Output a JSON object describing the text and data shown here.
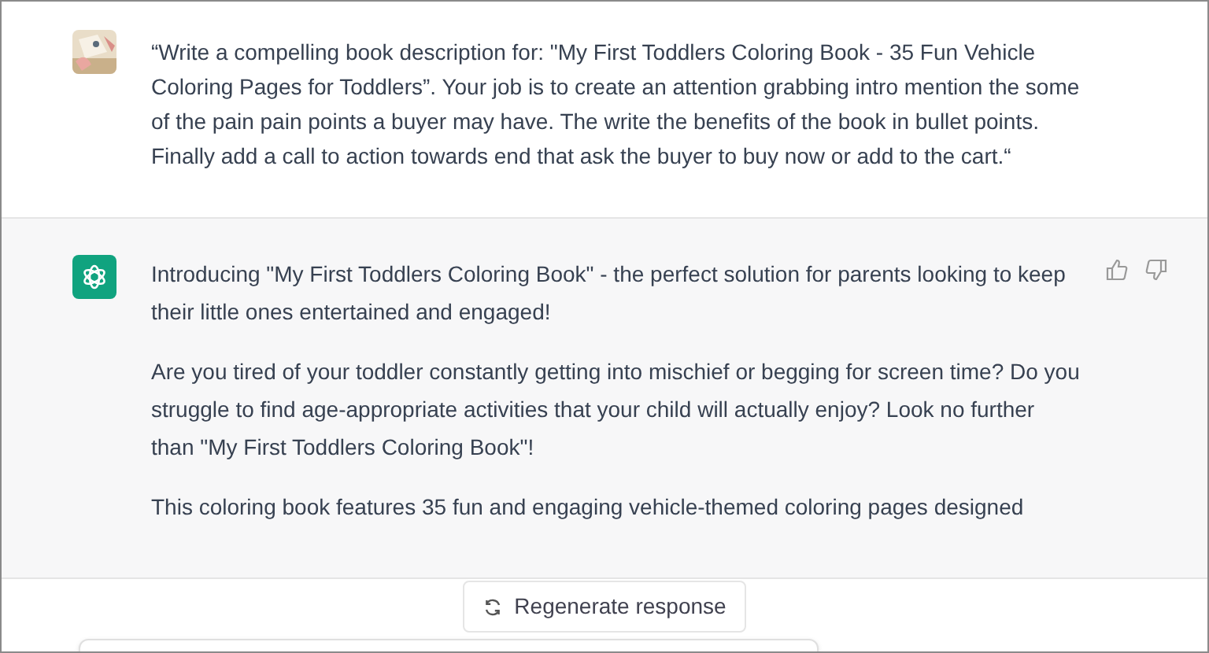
{
  "conversation": [
    {
      "kind": "user",
      "paragraphs": [
        "“Write a compelling book description for: \"My First Toddlers Coloring Book - 35 Fun Vehicle Coloring Pages for Toddlers”. Your job is to create an attention grabbing intro mention the some of the pain pain points a buyer may have. The write the benefits of the book in bullet points. Finally add a call to action towards end that ask the buyer to buy now or add to the cart.“"
      ]
    },
    {
      "kind": "assistant",
      "paragraphs": [
        "Introducing \"My First Toddlers Coloring Book\" - the perfect solution for parents looking to keep their little ones entertained and engaged!",
        "Are you tired of your toddler constantly getting into mischief or begging for screen time? Do you struggle to find age-appropriate activities that your child will actually enjoy? Look no further than \"My First Toddlers Coloring Book\"!",
        "This coloring book features 35 fun and engaging vehicle-themed coloring pages designed"
      ]
    }
  ],
  "regenerate_button": {
    "label": "Regenerate response"
  }
}
